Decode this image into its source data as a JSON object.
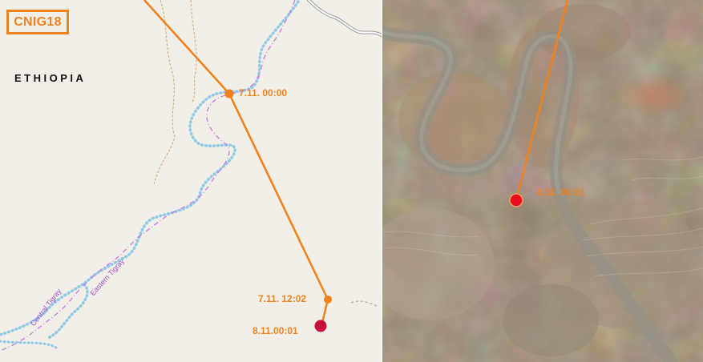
{
  "map_tag": "CNIG18",
  "country_label": "ETHIOPIA",
  "regions": {
    "central": "Central Tigray",
    "eastern": "Eastern Tigray"
  },
  "track_points": {
    "p1": "7.11. 00:00",
    "p2": "7.11. 12:02",
    "p3": "8.11.00:01"
  },
  "satellite_point_label": "8.11. 00:01",
  "colors": {
    "track": "#f0821e",
    "endpoint_map": "#c8103c",
    "endpoint_sat": "#e8101e",
    "boundary_blue": "#8ecae6",
    "boundary_purple": "#c878dc",
    "map_background": "#f2efe9"
  }
}
